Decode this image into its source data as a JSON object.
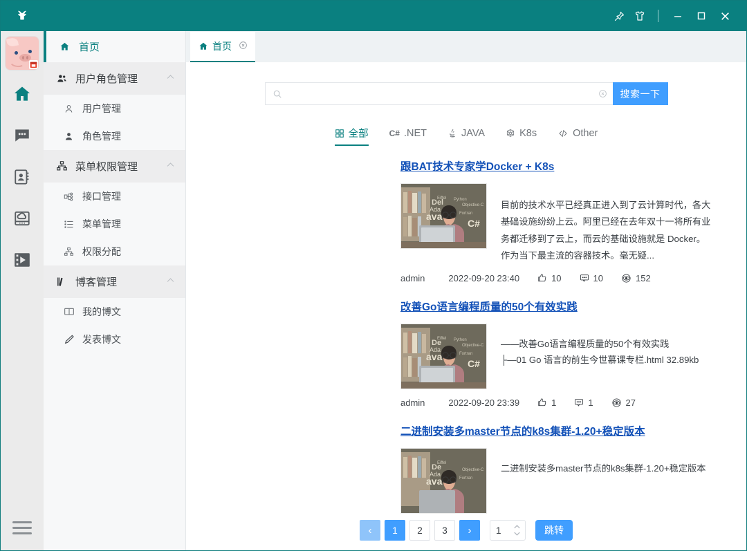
{
  "titlebar": {
    "logo_icon": "app-logo-icon",
    "pin_icon": "pin-icon",
    "skin_icon": "skin-shirt-icon",
    "minimize_label": "—",
    "maximize_label": "□",
    "close_label": "✕"
  },
  "rail": {
    "avatar_name": "pig-avatar",
    "icons": [
      {
        "name": "home-icon",
        "active": true
      },
      {
        "name": "chat-icon",
        "active": false
      },
      {
        "name": "contacts-icon",
        "active": false
      },
      {
        "name": "cloud-drive-icon",
        "active": false
      },
      {
        "name": "video-icon",
        "active": false
      }
    ],
    "menu_toggle": "hamburger-icon"
  },
  "nav": {
    "home_label": "首页",
    "groups": [
      {
        "label": "用户角色管理",
        "icon": "users-group-icon",
        "items": [
          {
            "label": "用户管理",
            "icon": "user-outline-icon"
          },
          {
            "label": "角色管理",
            "icon": "user-filled-icon"
          }
        ]
      },
      {
        "label": "菜单权限管理",
        "icon": "sitemap-icon",
        "items": [
          {
            "label": "接口管理",
            "icon": "api-node-icon"
          },
          {
            "label": "菜单管理",
            "icon": "list-icon"
          },
          {
            "label": "权限分配",
            "icon": "hierarchy-icon"
          }
        ]
      },
      {
        "label": "博客管理",
        "icon": "book-icon",
        "items": [
          {
            "label": "我的博文",
            "icon": "open-book-icon"
          },
          {
            "label": "发表博文",
            "icon": "pencil-icon"
          }
        ]
      }
    ]
  },
  "tabs": [
    {
      "label": "首页",
      "icon": "home-icon",
      "close_icon": "close-circle-icon",
      "active": true
    }
  ],
  "search": {
    "value": "",
    "placeholder": "",
    "icon": "search-icon",
    "clear_icon": "clear-circle-icon",
    "button_label": "搜索一下",
    "button_color": "#409eff"
  },
  "filters": [
    {
      "label": "全部",
      "icon": "grid-icon",
      "active": true
    },
    {
      "label": ".NET",
      "icon": "csharp-icon",
      "active": false
    },
    {
      "label": "JAVA",
      "icon": "java-icon",
      "active": false
    },
    {
      "label": "K8s",
      "icon": "kubernetes-icon",
      "active": false
    },
    {
      "label": "Other",
      "icon": "code-icon",
      "active": false
    }
  ],
  "filter_prefixes": {
    "dotnet": "C#"
  },
  "posts": [
    {
      "title": "跟BAT技术专家学Docker + K8s",
      "excerpt": "目前的技术水平已经真正进入到了云计算时代，各大基础设施纷纷上云。阿里已经在去年双十一将所有业务都迁移到了云上，而云的基础设施就是 Docker。作为当下最主流的容器技术。毫无疑...",
      "author": "admin",
      "date": "2022-09-20 23:40",
      "likes": "10",
      "comments": "10",
      "views": "152"
    },
    {
      "title": "改善Go语言编程质量的50个有效实践",
      "excerpt": "——改善Go语言编程质量的50个有效实践\n├—01 Go 语言的前生今世慕课专栏.html  32.89kb",
      "author": "admin",
      "date": "2022-09-20 23:39",
      "likes": "1",
      "comments": "1",
      "views": "27"
    },
    {
      "title": "二进制安装多master节点的k8s集群-1.20+稳定版本",
      "excerpt": "二进制安装多master节点的k8s集群-1.20+稳定版本",
      "author": "",
      "date": "",
      "likes": "",
      "comments": "",
      "views": ""
    }
  ],
  "meta_icons": {
    "like": "thumbs-up-icon",
    "comment": "comment-icon",
    "view": "eye-icon"
  },
  "pagination": {
    "prev_label": "‹",
    "next_label": "›",
    "pages": [
      "1",
      "2",
      "3"
    ],
    "active_page": "1",
    "jump_value": "1",
    "jump_label": "跳转",
    "accent": "#409eff"
  },
  "colors": {
    "header": "#0a8080",
    "accent_teal": "#0a8080",
    "accent_blue": "#409eff",
    "link": "#1452b8"
  }
}
